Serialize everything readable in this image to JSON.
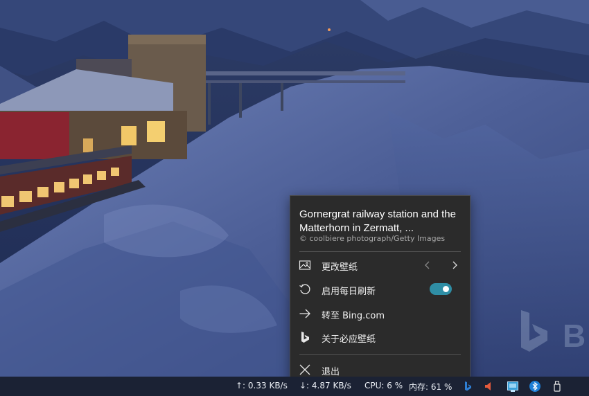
{
  "wallpaper": {
    "watermark_text": "Bi"
  },
  "flyout": {
    "title": "Gornergrat railway station and the Matterhorn in Zermatt, ...",
    "copyright": "©  coolbiere photograph/Getty Images",
    "menu": [
      {
        "label": "更改壁纸",
        "icon": "image-icon"
      },
      {
        "label": "启用每日刷新",
        "icon": "refresh-icon",
        "toggle_on": true
      },
      {
        "label": "转至 Bing.com",
        "icon": "arrow-right-icon"
      },
      {
        "label": "关于必应壁纸",
        "icon": "bing-logo-icon"
      },
      {
        "label": "退出",
        "icon": "close-icon"
      }
    ]
  },
  "taskbar": {
    "upload_speed": "↑: 0.33 KB/s",
    "download_speed": "↓: 4.87 KB/s",
    "cpu": "CPU: 6 %",
    "memory": "内存: 61 %"
  },
  "colors": {
    "flyout_bg": "#2b2b2b",
    "toggle_accent": "#2f8ea5",
    "taskbar_bg": "#1b2234"
  }
}
